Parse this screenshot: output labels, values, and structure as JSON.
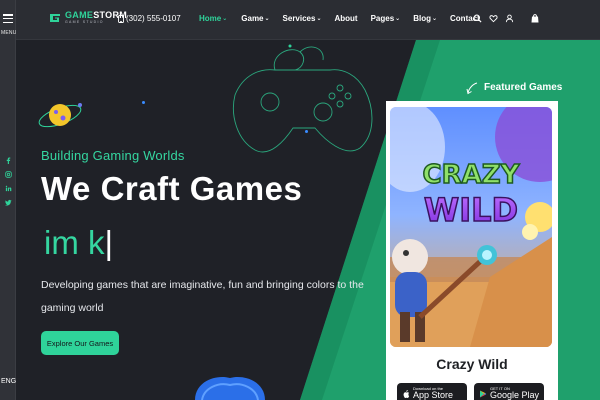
{
  "sidebar": {
    "menu_label": "MENU",
    "language": "ENG",
    "socials": [
      "facebook-icon",
      "instagram-icon",
      "linkedin-icon",
      "twitter-icon"
    ]
  },
  "brand": {
    "name_accent": "GAME",
    "name_rest": "STORM",
    "subtitle": "GAME STUDIO"
  },
  "header": {
    "phone": "(302) 555-0107",
    "nav": [
      {
        "label": "Home",
        "dropdown": true,
        "active": true
      },
      {
        "label": "Game",
        "dropdown": true,
        "active": false
      },
      {
        "label": "Services",
        "dropdown": true,
        "active": false
      },
      {
        "label": "About",
        "dropdown": false,
        "active": false
      },
      {
        "label": "Pages",
        "dropdown": true,
        "active": false
      },
      {
        "label": "Blog",
        "dropdown": true,
        "active": false
      },
      {
        "label": "Contact",
        "dropdown": false,
        "active": false
      }
    ],
    "icons": [
      "search-icon",
      "heart-icon",
      "user-icon",
      "bag-icon"
    ]
  },
  "hero": {
    "tagline": "Building Gaming Worlds",
    "headline": "We Craft Games",
    "typed_text": "im k",
    "cursor": "|",
    "description": "Developing games that are imaginative, fun and bringing colors to the gaming world",
    "cta_label": "Explore Our Games"
  },
  "featured": {
    "label": "Featured Games",
    "game_logo_line1": "CRAZY",
    "game_logo_line2": "WILD",
    "game_title": "Crazy Wild",
    "app_store": {
      "small": "Download on the",
      "big": "App Store"
    },
    "google_play": {
      "small": "GET IT ON",
      "big": "Google Play"
    }
  },
  "colors": {
    "accent": "#2fd39a",
    "background": "#1f2127",
    "header": "#2b2d33"
  }
}
